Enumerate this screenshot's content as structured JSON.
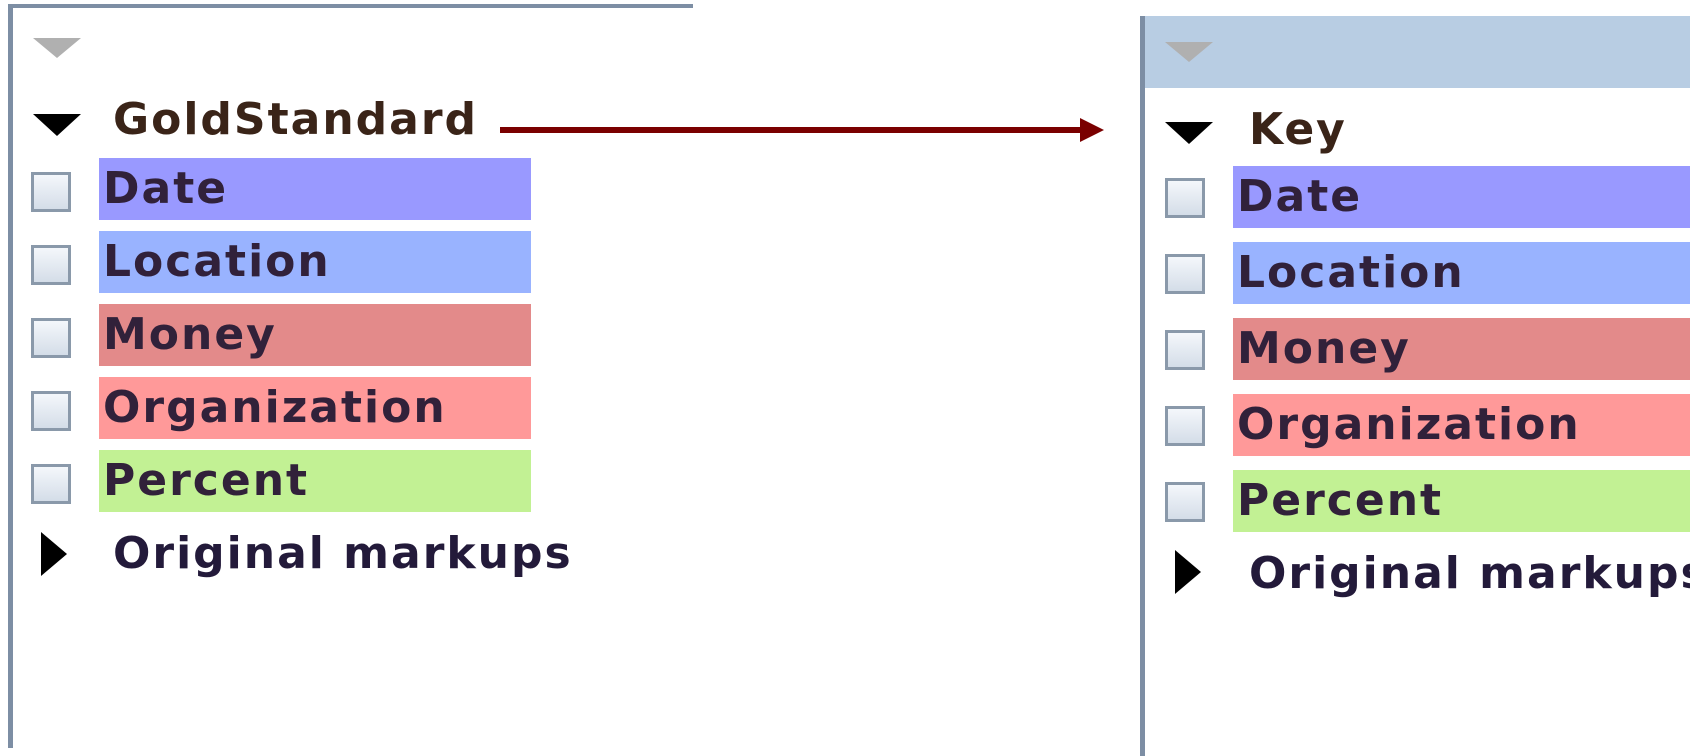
{
  "left_panel": {
    "group_title": "GoldStandard",
    "categories": [
      {
        "label": "Date",
        "color": "#9999ff"
      },
      {
        "label": "Location",
        "color": "#99b3ff"
      },
      {
        "label": "Money",
        "color": "#e38a8a"
      },
      {
        "label": "Organization",
        "color": "#ff9999"
      },
      {
        "label": "Percent",
        "color": "#c2f194"
      }
    ],
    "collapsed_group": "Original markups"
  },
  "right_panel": {
    "group_title": "Key",
    "categories": [
      {
        "label": "Date",
        "color": "#9999ff"
      },
      {
        "label": "Location",
        "color": "#99b3ff"
      },
      {
        "label": "Money",
        "color": "#e38a8a"
      },
      {
        "label": "Organization",
        "color": "#ff9999"
      },
      {
        "label": "Percent",
        "color": "#c2f194"
      }
    ],
    "collapsed_group": "Original markups"
  },
  "colors": {
    "arrow": "#7a0000",
    "panel_border": "#7d8ea4",
    "header_selected": "#b8cde3"
  }
}
